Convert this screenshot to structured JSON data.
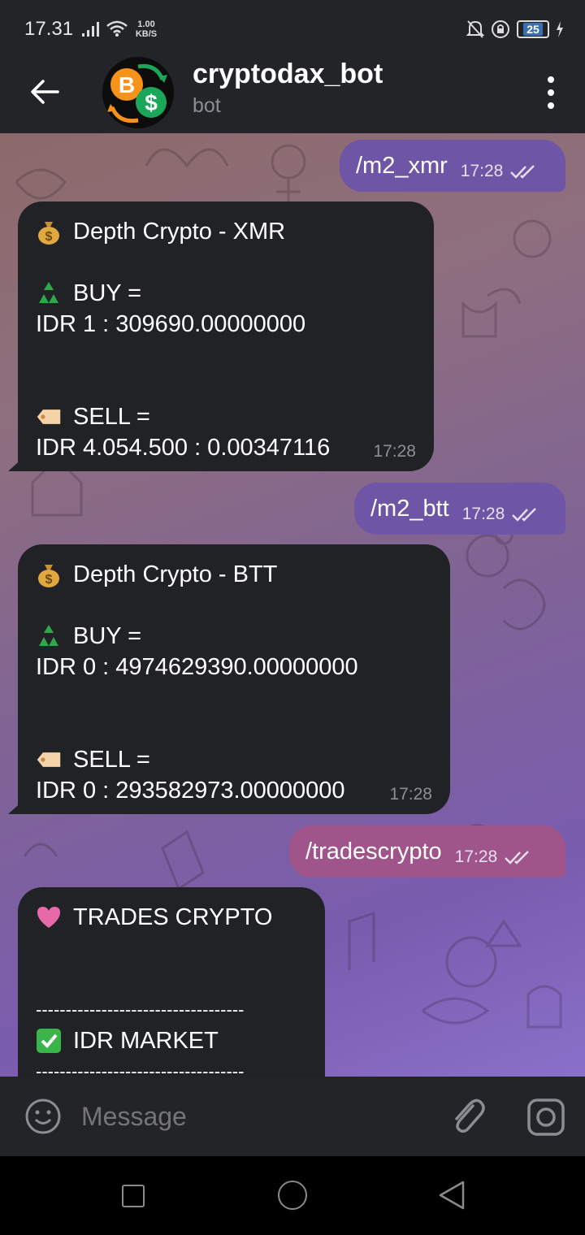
{
  "status": {
    "time": "17.31",
    "speed_value": "1.00",
    "speed_unit": "KB/S",
    "battery": "25"
  },
  "header": {
    "title": "cryptodax_bot",
    "subtitle": "bot"
  },
  "messages": {
    "m1": {
      "text": "/m2_xmr",
      "time": "17:28"
    },
    "m2": {
      "title": "Depth Crypto - XMR",
      "buy_label": "BUY =",
      "buy_value": "IDR 1 : 309690.00000000",
      "sell_label": "SELL =",
      "sell_value": "IDR 4.054.500 : 0.00347116",
      "time": "17:28"
    },
    "m3": {
      "text": "/m2_btt",
      "time": "17:28"
    },
    "m4": {
      "title": "Depth Crypto - BTT",
      "buy_label": "BUY =",
      "buy_value": "IDR 0 : 4974629390.00000000",
      "sell_label": "SELL =",
      "sell_value": "IDR 0 : 293582973.00000000",
      "time": "17:28"
    },
    "m5": {
      "text": "/tradescrypto",
      "time": "17:28"
    },
    "m6": {
      "title": "TRADES CRYPTO",
      "divider": "-----------------------------------",
      "market": "IDR MARKET"
    }
  },
  "composer": {
    "placeholder": "Message"
  },
  "colors": {
    "outgoing": "#6f55a6",
    "outgoing_pink": "#a0558a",
    "incoming": "#212226",
    "header": "#232427"
  }
}
